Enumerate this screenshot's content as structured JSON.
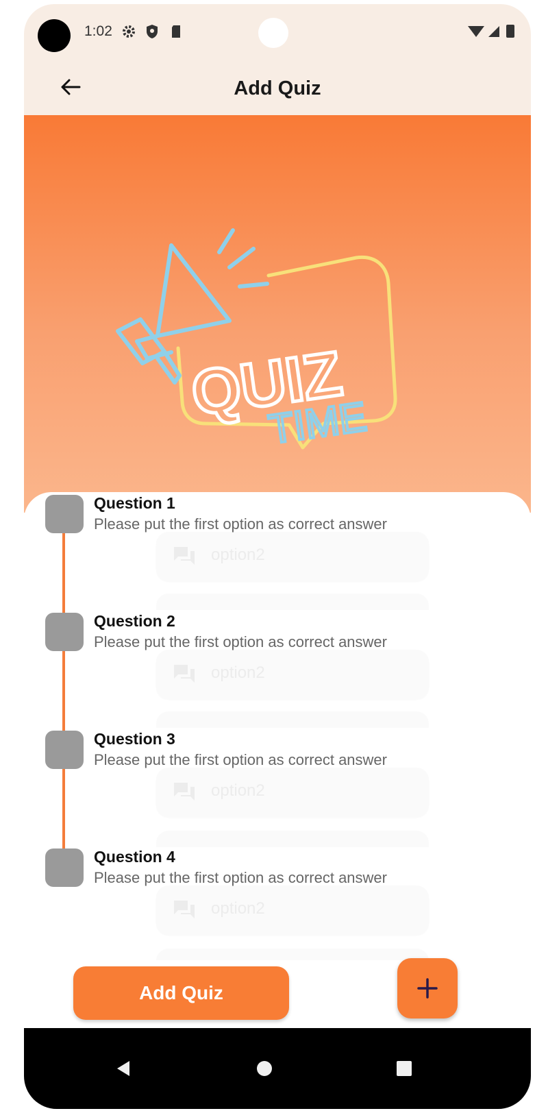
{
  "status_bar": {
    "time": "1:02"
  },
  "app_bar": {
    "title": "Add Quiz"
  },
  "hero": {
    "image_text_1": "QUIZ",
    "image_text_2": "TIME",
    "colors": {
      "top": "#f97a36",
      "bottom": "#fbb68c"
    }
  },
  "questions": [
    {
      "title": "Question 1",
      "subtitle": "Please put the first option as correct answer",
      "hidden_option": "option2"
    },
    {
      "title": "Question 2",
      "subtitle": "Please put the first option as correct answer",
      "hidden_option": "option2"
    },
    {
      "title": "Question 3",
      "subtitle": "Please put the first option as correct answer",
      "hidden_option": "option2"
    },
    {
      "title": "Question 4",
      "subtitle": "Please put the first option as correct answer",
      "hidden_option": "option2"
    }
  ],
  "actions": {
    "add_quiz_label": "Add Quiz",
    "fab_icon": "plus-icon"
  },
  "colors": {
    "accent": "#f87d35",
    "appbar_bg": "#f8ede4",
    "timeline": "#f47d3a",
    "box": "#9a9a9a"
  }
}
